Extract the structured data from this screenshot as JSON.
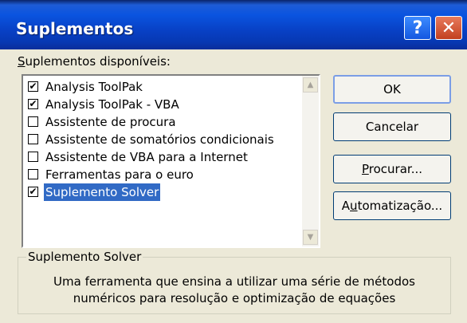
{
  "window": {
    "title": "Suplementos",
    "help_glyph": "?",
    "close_glyph": "✕"
  },
  "list": {
    "label_accel": "S",
    "label_rest": "uplementos disponíveis:",
    "items": [
      {
        "label": "Analysis ToolPak",
        "checked": true,
        "selected": false
      },
      {
        "label": "Analysis ToolPak - VBA",
        "checked": true,
        "selected": false
      },
      {
        "label": "Assistente de procura",
        "checked": false,
        "selected": false
      },
      {
        "label": "Assistente de somatórios condicionais",
        "checked": false,
        "selected": false
      },
      {
        "label": "Assistente de VBA para a Internet",
        "checked": false,
        "selected": false
      },
      {
        "label": "Ferramentas para o euro",
        "checked": false,
        "selected": false
      },
      {
        "label": "Suplemento Solver",
        "checked": true,
        "selected": true
      }
    ]
  },
  "check_glyph": "✔",
  "buttons": {
    "ok": "OK",
    "cancel": "Cancelar",
    "browse_accel": "P",
    "browse_rest": "rocurar...",
    "auto_pre": "A",
    "auto_accel": "u",
    "auto_rest": "tomatização..."
  },
  "description": {
    "title": "Suplemento Solver",
    "line1": "Uma ferramenta que ensina a utilizar uma série de métodos",
    "line2": "numéricos para resolução e optimização de equações"
  },
  "colors": {
    "title_bar": "#0a54e0",
    "selection": "#316ac5",
    "dialog_bg": "#ece9d8"
  }
}
